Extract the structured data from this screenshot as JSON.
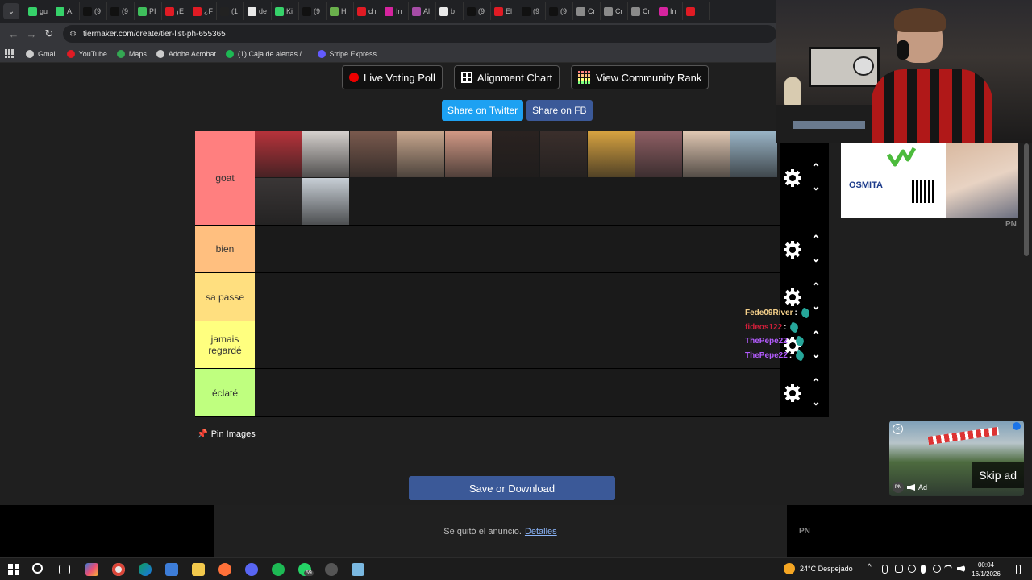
{
  "browser": {
    "tabs": [
      {
        "label": "gu",
        "color": "#36d26a"
      },
      {
        "label": "A:",
        "color": "#36d26a"
      },
      {
        "label": "(9",
        "color": "#111111"
      },
      {
        "label": "(9",
        "color": "#111111"
      },
      {
        "label": "PI",
        "color": "#3fbf5c"
      },
      {
        "label": "¡E",
        "color": "#e01b24"
      },
      {
        "label": "¿F",
        "color": "#e01b24"
      },
      {
        "label": "(1",
        "color": "#222222"
      },
      {
        "label": "de",
        "color": "#e8e8e8"
      },
      {
        "label": "Ki",
        "color": "#36d26a"
      },
      {
        "label": "(9",
        "color": "#111111"
      },
      {
        "label": "H",
        "color": "#6ab04c"
      },
      {
        "label": "ch",
        "color": "#e01b24"
      },
      {
        "label": "In",
        "color": "#d6249f"
      },
      {
        "label": "Al",
        "color": "#a64ca6"
      },
      {
        "label": "b",
        "color": "#e8e8e8"
      },
      {
        "label": "(9",
        "color": "#111111"
      },
      {
        "label": "El",
        "color": "#e01b24"
      },
      {
        "label": "(9",
        "color": "#111111"
      },
      {
        "label": "(9",
        "color": "#111111"
      },
      {
        "label": "Cr",
        "color": "#8a8a8a"
      },
      {
        "label": "Cr",
        "color": "#8a8a8a"
      },
      {
        "label": "Cr",
        "color": "#8a8a8a"
      },
      {
        "label": "In",
        "color": "#d6249f"
      },
      {
        "label": "",
        "color": "#e01b24"
      }
    ],
    "url": "tiermaker.com/create/tier-list-ph-655365",
    "bookmarks": [
      {
        "label": "Gmail",
        "color": "#cccccc"
      },
      {
        "label": "YouTube",
        "color": "#e01b24"
      },
      {
        "label": "Maps",
        "color": "#34a853"
      },
      {
        "label": "Adobe Acrobat",
        "color": "#cccccc"
      },
      {
        "label": "(1) Caja de alertas /...",
        "color": "#1db954"
      },
      {
        "label": "Stripe Express",
        "color": "#635bff"
      }
    ]
  },
  "page": {
    "buttons": {
      "live_voting": "Live Voting Poll",
      "alignment": "Alignment Chart",
      "community_rank": "View Community Rank"
    },
    "share": {
      "twitter": "Share on Twitter",
      "facebook": "Share on FB"
    },
    "tiers": [
      {
        "label": "goat",
        "color": "#ff7f7f"
      },
      {
        "label": "bien",
        "color": "#ffbf7f"
      },
      {
        "label": "sa passe",
        "color": "#ffdf7f"
      },
      {
        "label": "jamais regardé",
        "color": "#ffff7f"
      },
      {
        "label": "éclaté",
        "color": "#bfff7f"
      }
    ],
    "goat_images": [
      {
        "color": "#b8333b"
      },
      {
        "color": "#d7d2cf"
      },
      {
        "color": "#7a5a4e"
      },
      {
        "color": "#c9a88f"
      },
      {
        "color": "#d39a86"
      },
      {
        "color": "#2a2220"
      },
      {
        "color": "#3b2f2c"
      },
      {
        "color": "#d9a441"
      },
      {
        "color": "#8f5f64"
      },
      {
        "color": "#e2c9b4"
      },
      {
        "color": "#9bb6c8"
      },
      {
        "color": "#3a3636"
      },
      {
        "color": "#c8cfd6"
      }
    ],
    "pin_images": "Pin Images",
    "save": "Save or Download",
    "ad_removed": "Se quitó el anuncio.",
    "ad_details": "Detalles",
    "pn_mark": "PN"
  },
  "chat": [
    {
      "user": "Fede09River",
      "sep": ":",
      "color": "#f5d08a"
    },
    {
      "user": "fideos122",
      "sep": ":",
      "color": "#d11f3a"
    },
    {
      "user": "ThePepe22",
      "sep": ":",
      "color": "#b45cff"
    },
    {
      "user": "ThePepe22",
      "sep": ":",
      "color": "#b45cff"
    }
  ],
  "ads": {
    "brand": "OSMITA",
    "skip": "Skip ad",
    "ad_label": "Ad",
    "pn": "PN"
  },
  "taskbar": {
    "weather": "24°C  Despejado",
    "time": "00:04",
    "date": "16/1/2026",
    "whatsapp_badge": "59"
  }
}
